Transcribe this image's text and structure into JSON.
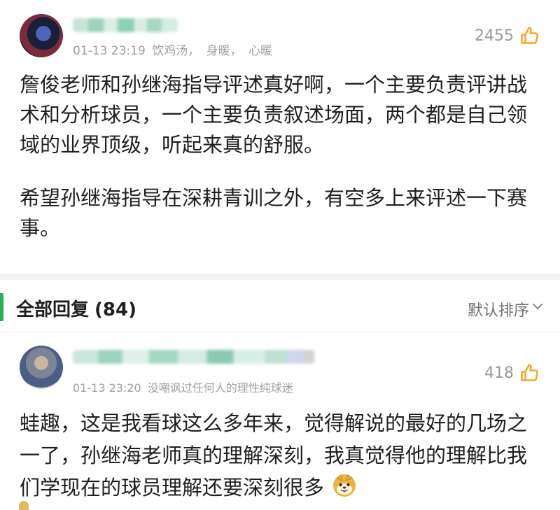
{
  "post": {
    "author_name": "",
    "timestamp": "01-13 23:19",
    "tags": [
      "饮鸡汤，",
      "身暖，",
      "心暖"
    ],
    "likes": "2455",
    "body_paragraphs": [
      "詹俊老师和孙继海指导评述真好啊，一个主要负责评讲战术和分析球员，一个主要负责叙述场面，两个都是自己领域的业界顶级，听起来真的舒服。",
      "希望孙继海指导在深耕青训之外，有空多上来评述一下赛事。"
    ]
  },
  "replies_header": {
    "title": "全部回复",
    "count": "(84)",
    "sort_label": "默认排序",
    "accent_color": "#2AB14E"
  },
  "reply": {
    "author_name": "",
    "timestamp": "01-13 23:20",
    "tag": "没嘲讽过任何人的理性纯球迷",
    "likes": "418",
    "body": "蛙趣，这是我看球这么多年来，觉得解说的最好的几场之一了，孙继海老师真的理解深刻，我真觉得他的理解比我们学现在的球员理解还要深刻很多",
    "emoji_icon": "shiba-dog-icon"
  },
  "colors": {
    "meta_text": "#A0A0A0",
    "body_text": "#1F1F1F",
    "like_icon": "#F5A623",
    "divider": "#F3F3F3"
  }
}
